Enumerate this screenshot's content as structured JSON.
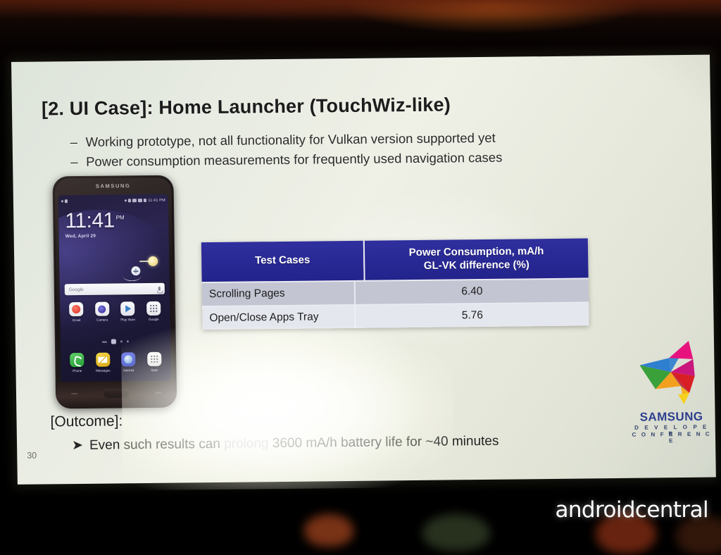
{
  "slide": {
    "title": "[2. UI Case]: Home Launcher (TouchWiz-like)",
    "bullets": [
      {
        "marker": "–",
        "text": "Working prototype, not all functionality for Vulkan version supported yet"
      },
      {
        "marker": "–",
        "text": "Power consumption measurements for frequently used navigation cases"
      }
    ],
    "outcome_heading": "[Outcome]:",
    "outcome_marker": "➤",
    "outcome_text_start": "Even such results can",
    "outcome_text_faded": "prolong",
    "outcome_text_end": "3600 mA/h battery life for ~40 minutes",
    "page_number": "30",
    "background_color": "#e7ebe2",
    "accent_color": "#23238c"
  },
  "table": {
    "headers": [
      "Test Cases",
      "Power Consumption, mA/h\nGL-VK difference (%)"
    ],
    "header_line1": "Power Consumption, mA/h",
    "header_line2": "GL-VK difference (%)",
    "rows": [
      {
        "test_case": "Scrolling Pages",
        "power_consumption": "6.40"
      },
      {
        "test_case": "Open/Close Apps Tray",
        "power_consumption": "5.76"
      }
    ],
    "header_bg": "#23238c",
    "row1_bg": "#c3c5d2",
    "row2_bg": "#e5e7ee"
  },
  "phone": {
    "brand": "SAMSUNG",
    "status_time": "11:41 PM",
    "clock_time": "11:41",
    "clock_ampm": "PM",
    "clock_date": "Wed, April 29",
    "search_placeholder": "Google",
    "app_row_top": [
      {
        "label": "Email",
        "icon": "email-icon"
      },
      {
        "label": "Camera",
        "icon": "camera-icon"
      },
      {
        "label": "Play Store",
        "icon": "play-store-icon"
      },
      {
        "label": "Google",
        "icon": "google-folder-icon"
      }
    ],
    "app_row_dock": [
      {
        "label": "Phone",
        "icon": "phone-icon"
      },
      {
        "label": "Messages",
        "icon": "messages-icon"
      },
      {
        "label": "Internet",
        "icon": "internet-icon"
      },
      {
        "label": "Apps",
        "icon": "apps-icon"
      }
    ]
  },
  "logo": {
    "name": "SAMSUNG",
    "sub1": "D E V E L O P E R",
    "sub2": "C O N F E R E N C E",
    "mark_colors": [
      "#2f7fd0",
      "#3aa03a",
      "#e8127f",
      "#d81f26",
      "#f2a01e",
      "#f5d020",
      "#6a3fa0"
    ]
  },
  "watermark": {
    "text": "androidcentral"
  }
}
